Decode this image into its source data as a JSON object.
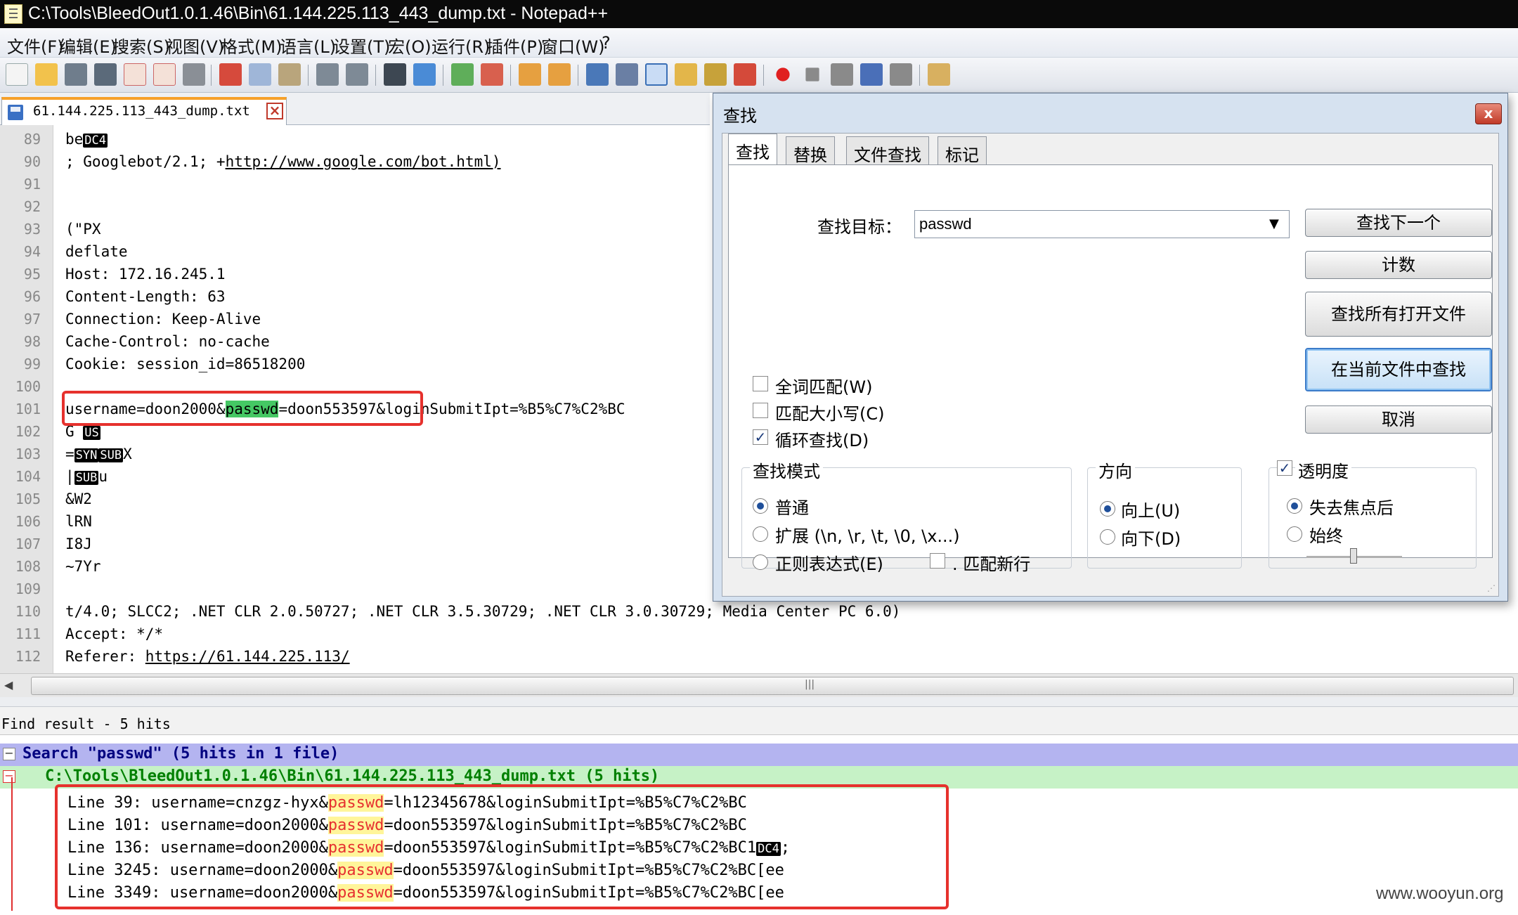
{
  "window": {
    "title": "C:\\Tools\\BleedOut1.0.1.46\\Bin\\61.144.225.113_443_dump.txt - Notepad++"
  },
  "menu": [
    "文件(F)",
    "编辑(E)",
    "搜索(S)",
    "视图(V)",
    "格式(M)",
    "语言(L)",
    "设置(T)",
    "宏(O)",
    "运行(R)",
    "插件(P)",
    "窗口(W)",
    "?"
  ],
  "tab": {
    "label": "61.144.225.113_443_dump.txt"
  },
  "editor": {
    "lines": [
      {
        "n": "89"
      },
      {
        "n": "90"
      },
      {
        "n": "91"
      },
      {
        "n": "92"
      },
      {
        "n": "93"
      },
      {
        "n": "94"
      },
      {
        "n": "95"
      },
      {
        "n": "96"
      },
      {
        "n": "97"
      },
      {
        "n": "98"
      },
      {
        "n": "99"
      },
      {
        "n": "100"
      },
      {
        "n": "101"
      },
      {
        "n": "102"
      },
      {
        "n": "103"
      },
      {
        "n": "104"
      },
      {
        "n": "105"
      },
      {
        "n": "106"
      },
      {
        "n": "107"
      },
      {
        "n": "108"
      },
      {
        "n": "109"
      },
      {
        "n": "110"
      },
      {
        "n": "111"
      },
      {
        "n": "112"
      }
    ],
    "l89": {
      "pre": "be",
      "ctrl": "DC4"
    },
    "l90": {
      "pre": "; Googlebot/2.1; +",
      "link": "http://www.google.com/bot.html)"
    },
    "l93": "(\"PX",
    "l94": "deflate",
    "l95": "Host: 172.16.245.1",
    "l96": "Content-Length: 63",
    "l97": "Connection: Keep-Alive",
    "l98": "Cache-Control: no-cache",
    "l99": "Cookie: session_id=86518200",
    "l101": {
      "pre": "username=doon2000&",
      "match": "passwd",
      "post": "=doon553597&loginSubmitIpt=%B5%C7%C2%BC"
    },
    "l102": {
      "pre": "G ",
      "ctrl": "US"
    },
    "l103": {
      "pre": "=",
      "ctrl1": "SYN",
      "ctrl2": "SUB",
      "post": "X"
    },
    "l104": {
      "pre": "|",
      "ctrl": "SUB",
      "post": "u"
    },
    "l105": "&W2",
    "l106": "lRN",
    "l107": "I8J",
    "l108": "~7Yr",
    "l110": "t/4.0; SLCC2; .NET CLR 2.0.50727; .NET CLR 3.5.30729; .NET CLR 3.0.30729; Media Center PC 6.0)",
    "l111": "Accept: */*",
    "l112": {
      "pre": "Referer: ",
      "link": "https://61.144.225.113/"
    }
  },
  "find_panel": {
    "title": "Find result - 5 hits",
    "search_line": "Search \"passwd\" (5 hits in 1 file)",
    "file_line": "C:\\Tools\\BleedOut1.0.1.46\\Bin\\61.144.225.113_443_dump.txt (5 hits)",
    "results": [
      {
        "prefix": "Line 39: username=cnzgz-hyx&",
        "match": "passwd",
        "suffix": "=lh12345678&loginSubmitIpt=%B5%C7%C2%BC",
        "ctrl": "",
        "tail": ""
      },
      {
        "prefix": "Line 101: username=doon2000&",
        "match": "passwd",
        "suffix": "=doon553597&loginSubmitIpt=%B5%C7%C2%BC",
        "ctrl": "",
        "tail": ""
      },
      {
        "prefix": "Line 136: username=doon2000&",
        "match": "passwd",
        "suffix": "=doon553597&loginSubmitIpt=%B5%C7%C2%BC1",
        "ctrl": "DC4",
        "tail": ";"
      },
      {
        "prefix": "Line 3245: username=doon2000&",
        "match": "passwd",
        "suffix": "=doon553597&loginSubmitIpt=%B5%C7%C2%BC[ee",
        "ctrl": "",
        "tail": ""
      },
      {
        "prefix": "Line 3349: username=doon2000&",
        "match": "passwd",
        "suffix": "=doon553597&loginSubmitIpt=%B5%C7%C2%BC[ee",
        "ctrl": "",
        "tail": ""
      }
    ]
  },
  "dialog": {
    "title": "查找",
    "close": "x",
    "tabs": [
      "查找",
      "替换",
      "文件查找",
      "标记"
    ],
    "find_label": "查找目标：",
    "find_value": "passwd",
    "buttons": [
      "查找下一个",
      "计数",
      "查找所有打开文件",
      "在当前文件中查找",
      "取消"
    ],
    "options": [
      {
        "label": "全词匹配(W)",
        "checked": false
      },
      {
        "label": "匹配大小写(C)",
        "checked": false
      },
      {
        "label": "循环查找(D)",
        "checked": true
      }
    ],
    "mode": {
      "title": "查找模式",
      "items": [
        "普通",
        "扩展 (\\n, \\r, \\t, \\0, \\x...)",
        "正则表达式(E)"
      ],
      "selected": 0,
      "newline_label": ". 匹配新行"
    },
    "direction": {
      "title": "方向",
      "items": [
        "向上(U)",
        "向下(D)"
      ],
      "selected": 0
    },
    "transparency": {
      "title": "透明度",
      "checked": true,
      "items": [
        "失去焦点后",
        "始终"
      ],
      "selected": 0
    }
  },
  "watermark": "www.wooyun.org"
}
